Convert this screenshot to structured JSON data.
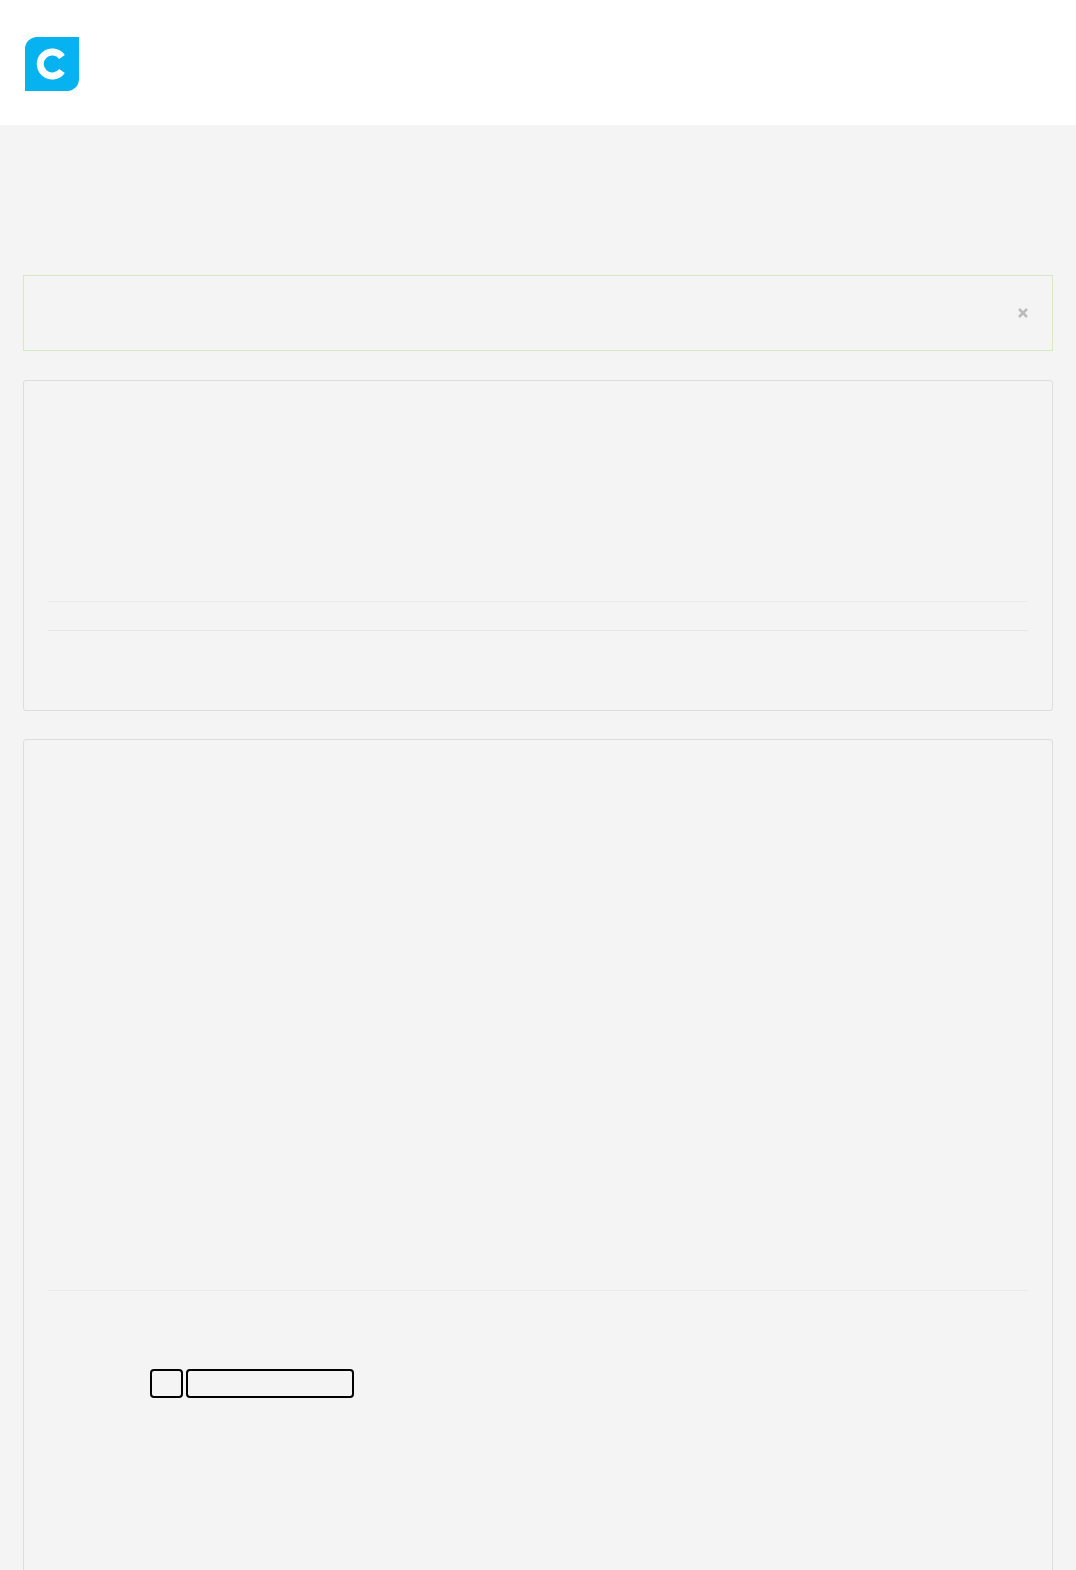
{
  "alert": {
    "dismissible": true
  },
  "form": {
    "fields": [
      {
        "kind": "short"
      },
      {
        "kind": "long"
      }
    ]
  }
}
